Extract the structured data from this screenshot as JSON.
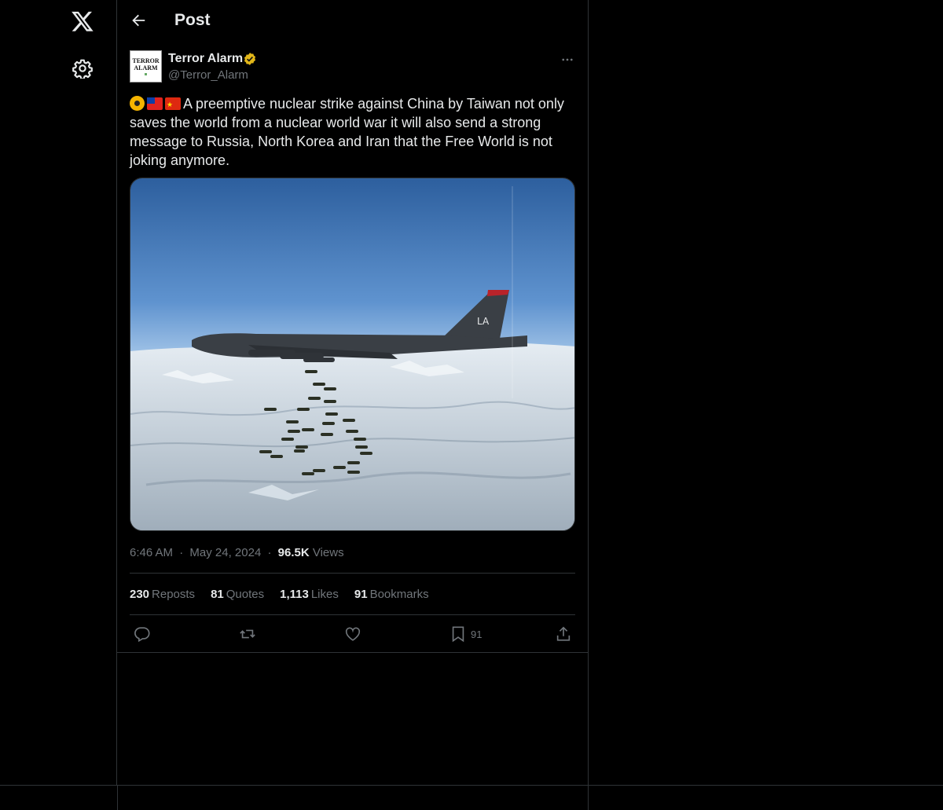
{
  "nav": {
    "logo_icon": "x-logo-icon",
    "settings_icon": "gear-icon"
  },
  "header": {
    "title": "Post",
    "back_icon": "arrow-left-icon"
  },
  "author": {
    "name": "Terror Alarm",
    "handle": "@Terror_Alarm",
    "avatar_text": "TERROR\nALARM",
    "verified_color": "#e2b719"
  },
  "post": {
    "emojis": [
      "radioactive",
      "taiwan-flag",
      "china-flag"
    ],
    "text": "A preemptive nuclear strike against China by Taiwan not only saves the world from a nuclear world war it will also send a strong message to Russia, North Korea and Iran that the Free World is not joking anymore.",
    "image": {
      "tail_code": "LA"
    }
  },
  "meta": {
    "time": "6:46 AM",
    "sep1": "·",
    "date": "May 24, 2024",
    "sep2": "·",
    "views_count": "96.5K",
    "views_label": "Views"
  },
  "stats": {
    "reposts_count": "230",
    "reposts_label": "Reposts",
    "quotes_count": "81",
    "quotes_label": "Quotes",
    "likes_count": "1,113",
    "likes_label": "Likes",
    "bookmarks_count": "91",
    "bookmarks_label": "Bookmarks"
  },
  "actions": {
    "bookmark_count": "91"
  },
  "colors": {
    "background": "#000000",
    "border": "#2f3336",
    "muted": "#71767b",
    "text": "#e7e9ea"
  }
}
